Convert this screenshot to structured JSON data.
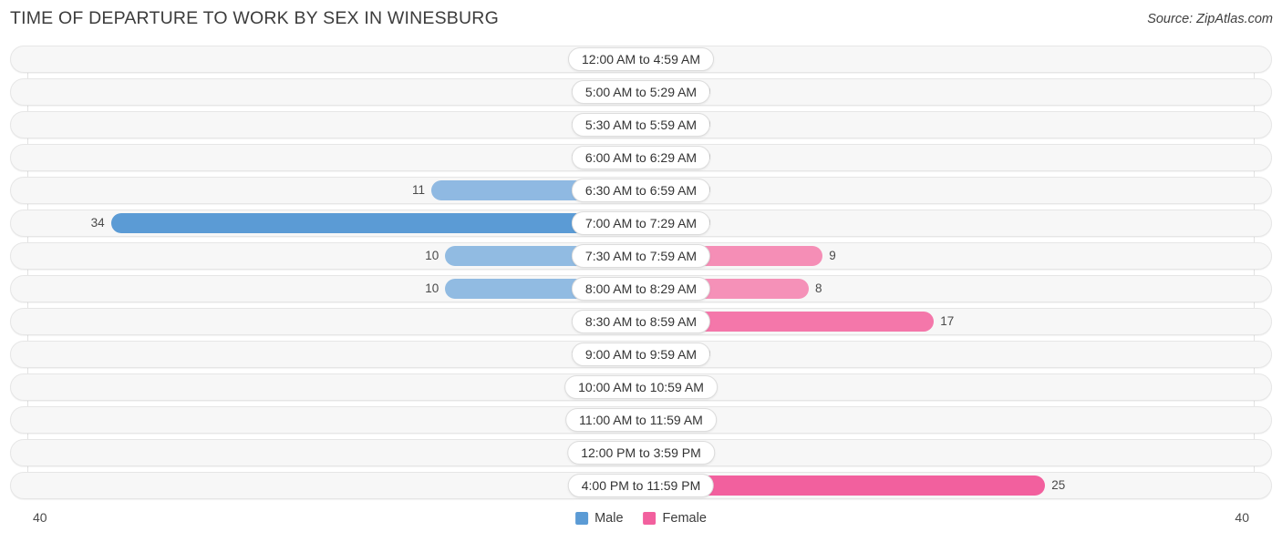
{
  "header": {
    "title": "TIME OF DEPARTURE TO WORK BY SEX IN WINESBURG",
    "source": "Source: ZipAtlas.com"
  },
  "axis": {
    "left_max_label": "40",
    "right_max_label": "40",
    "max_value": 40
  },
  "legend": {
    "items": [
      {
        "label": "Male",
        "color": "#5B9BD5"
      },
      {
        "label": "Female",
        "color": "#F2609E"
      }
    ]
  },
  "colors": {
    "male_base": "#A8C8E8",
    "male_max": "#5B9BD5",
    "female_base": "#F7A8C4",
    "female_max": "#F2609E",
    "track_bg": "#f7f7f7",
    "track_border": "#e6e6e6",
    "gridline": "#e2e2e2"
  },
  "chart_data": {
    "type": "bar",
    "title": "TIME OF DEPARTURE TO WORK BY SEX IN WINESBURG",
    "xlabel": "",
    "ylabel": "",
    "orientation": "horizontal-diverging",
    "xlim": [
      40,
      40
    ],
    "grid": true,
    "legend_position": "bottom-center",
    "categories": [
      "12:00 AM to 4:59 AM",
      "5:00 AM to 5:29 AM",
      "5:30 AM to 5:59 AM",
      "6:00 AM to 6:29 AM",
      "6:30 AM to 6:59 AM",
      "7:00 AM to 7:29 AM",
      "7:30 AM to 7:59 AM",
      "8:00 AM to 8:29 AM",
      "8:30 AM to 8:59 AM",
      "9:00 AM to 9:59 AM",
      "10:00 AM to 10:59 AM",
      "11:00 AM to 11:59 AM",
      "12:00 PM to 3:59 PM",
      "4:00 PM to 11:59 PM"
    ],
    "series": [
      {
        "name": "Male",
        "values": [
          0,
          0,
          0,
          0,
          11,
          34,
          10,
          10,
          0,
          0,
          0,
          0,
          0,
          0
        ]
      },
      {
        "name": "Female",
        "values": [
          0,
          0,
          0,
          0,
          0,
          0,
          9,
          8,
          17,
          0,
          0,
          0,
          0,
          25
        ]
      }
    ]
  }
}
